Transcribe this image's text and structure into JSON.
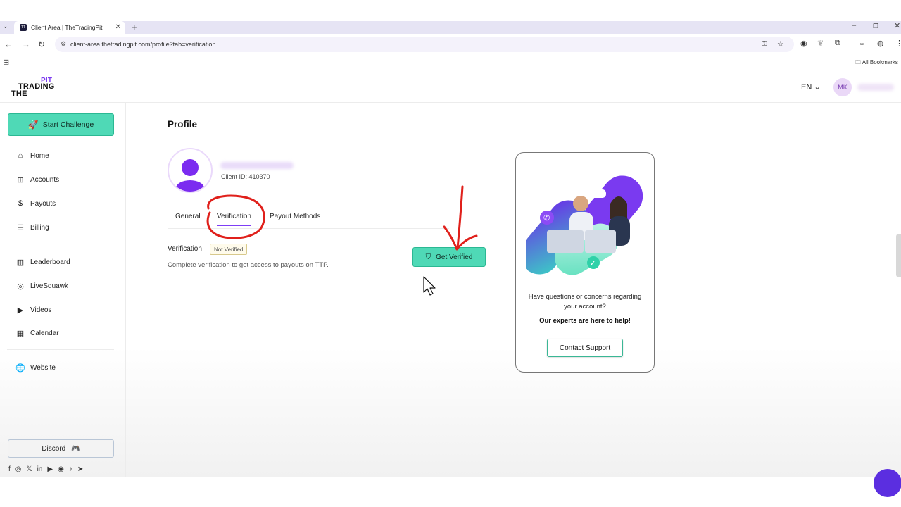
{
  "browser": {
    "tab_title": "Client Area | TheTradingPit",
    "url": "client-area.thetradingpit.com/profile?tab=verification",
    "all_bookmarks": "All Bookmarks"
  },
  "header": {
    "logo_pit": "PIT",
    "logo_trading": "TRADING",
    "logo_the": "THE",
    "lang": "EN",
    "avatar_initials": "MK"
  },
  "sidebar": {
    "start_challenge": "Start Challenge",
    "items": [
      {
        "label": "Home",
        "icon": "home-icon"
      },
      {
        "label": "Accounts",
        "icon": "grid-icon"
      },
      {
        "label": "Payouts",
        "icon": "payout-icon"
      },
      {
        "label": "Billing",
        "icon": "billing-icon"
      },
      {
        "label": "Leaderboard",
        "icon": "leaderboard-icon"
      },
      {
        "label": "LiveSquawk",
        "icon": "livesquawk-icon"
      },
      {
        "label": "Videos",
        "icon": "video-icon"
      },
      {
        "label": "Calendar",
        "icon": "calendar-icon"
      },
      {
        "label": "Website",
        "icon": "globe-icon"
      }
    ],
    "discord": "Discord"
  },
  "profile": {
    "title": "Profile",
    "client_id": "Client ID: 410370",
    "tabs": [
      "General",
      "Verification",
      "Payout Methods"
    ],
    "active_tab": "Verification",
    "verification_label": "Verification",
    "status_badge": "Not Verified",
    "description": "Complete verification to get access to payouts on TTP.",
    "get_verified": "Get Verified"
  },
  "support_card": {
    "question": "Have questions or concerns regarding your account?",
    "help": "Our experts are here to help!",
    "button": "Contact Support"
  },
  "colors": {
    "accent_green": "#4fd9b6",
    "brand_purple": "#7e3ef5",
    "annotation_red": "#e0201b"
  }
}
